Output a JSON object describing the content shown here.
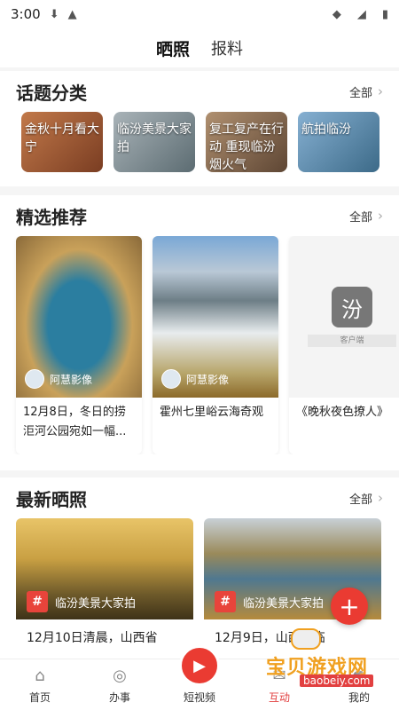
{
  "status": {
    "time": "3:00"
  },
  "top_tabs": [
    {
      "label": "晒照"
    },
    {
      "label": "报料"
    }
  ],
  "topics": {
    "title": "话题分类",
    "more": "全部",
    "items": [
      {
        "label": "金秋十月看大宁",
        "color": "#b86a4a"
      },
      {
        "label": "临汾美景大家拍",
        "color": "#7e8e92"
      },
      {
        "label": "复工复产在行动 重现临汾烟火气",
        "color": "#8c7058"
      },
      {
        "label": "航拍临汾",
        "color": "#5a86a8"
      }
    ]
  },
  "featured": {
    "title": "精选推荐",
    "more": "全部",
    "cards": [
      {
        "author": "阿慧影像",
        "caption": "12月8日，冬日的捞洰河公园宛如一幅...",
        "bg": "#3b6f7c"
      },
      {
        "author": "阿慧影像",
        "caption": "霍州七里峪云海奇观",
        "bg": "#6e8fa8"
      },
      {
        "author": "",
        "caption": "《晚秋夜色撩人》",
        "bg": "#f2f2f2",
        "placeholder_label": "客户端"
      }
    ]
  },
  "latest": {
    "title": "最新晒照",
    "more": "全部",
    "cards": [
      {
        "tag": "临汾美景大家拍",
        "caption": "12月10日清晨，山西省",
        "bg": "#b08a3a"
      },
      {
        "tag": "临汾美景大家拍",
        "caption": "12月9日，山西省临",
        "bg": "#8a7a52"
      }
    ]
  },
  "bottom_nav": [
    {
      "label": "首页",
      "icon": "home-icon"
    },
    {
      "label": "办事",
      "icon": "compass-icon"
    },
    {
      "label": "短视频",
      "icon": "play-icon"
    },
    {
      "label": "互动",
      "icon": "chat-icon"
    },
    {
      "label": "我的",
      "icon": "user-icon"
    }
  ],
  "watermark": {
    "text": "宝贝游戏网",
    "url": "baobeiy.com"
  }
}
